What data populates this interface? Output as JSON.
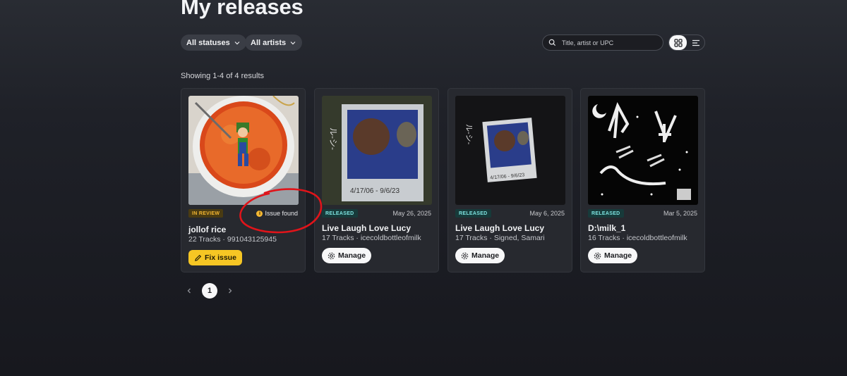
{
  "header": {
    "title": "My releases"
  },
  "filters": {
    "status_label": "All statuses",
    "artist_label": "All artists",
    "search_placeholder": "Title, artist or UPC"
  },
  "results_text": "Showing 1-4 of 4 results",
  "releases": [
    {
      "status": "IN REVIEW",
      "issue_text": "Issue found",
      "title": "jollof rice",
      "subtitle": "22 Tracks · 991043125945",
      "action": "Fix issue"
    },
    {
      "status": "RELEASED",
      "date": "May 26, 2025",
      "title": "Live Laugh Love Lucy",
      "subtitle": "17 Tracks · icecoldbottleofmilk",
      "action": "Manage"
    },
    {
      "status": "RELEASED",
      "date": "May 6, 2025",
      "title": "Live Laugh Love Lucy",
      "subtitle": "17 Tracks · Signed, Samari",
      "action": "Manage"
    },
    {
      "status": "RELEASED",
      "date": "Mar 5, 2025",
      "title": "D:\\milk_1",
      "subtitle": "16 Tracks · icecoldbottleofmilk",
      "action": "Manage"
    }
  ],
  "pagination": {
    "current": "1"
  },
  "colors": {
    "accent_yellow": "#f6c624",
    "released_teal": "#7de3e0",
    "annotation_red": "#e0141a"
  }
}
